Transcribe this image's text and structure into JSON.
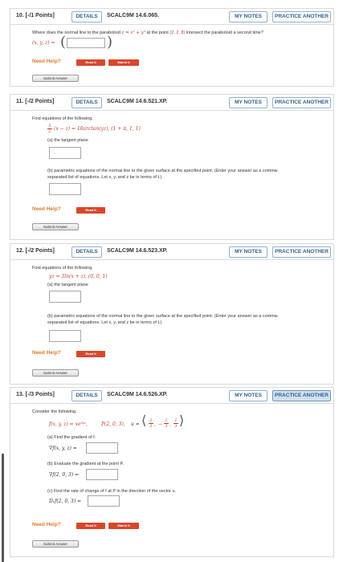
{
  "common": {
    "details_label": "DETAILS",
    "my_notes_label": "MY NOTES",
    "practice_label": "PRACTICE ANOTHER",
    "need_help": "Need Help?",
    "read_it": "Read It",
    "watch_it": "Watch It",
    "submit_answer": "Submit Answer"
  },
  "q10": {
    "number": "10. [-/1 Points]",
    "code": "SCALC9M 14.6.065.",
    "prompt_start": "Where does the normal line to the paraboloid ",
    "prompt_expr": "z = x² + y²",
    "prompt_mid": " at the point ",
    "prompt_point": "(2, 2, 8)",
    "prompt_end": " intersect the paraboloid a second time?",
    "answer_label": "(x, y, z) ="
  },
  "q11": {
    "number": "11. [-/2 Points]",
    "code": "SCALC9M 14.6.521.XP.",
    "prompt": "Find equations of the following.",
    "frac_num": "5",
    "frac_den": "2",
    "equation": "(x − z) = 10arctan(yz),   (1 + π, 1, 1)",
    "part_a": "(a) the tangent plane",
    "part_b_line1": "(b) parametric equations of the normal line to the given surface at the specified point. (Enter your answer as a comma-",
    "part_b_line2": "separated list of equations. Let x, y, and z be in terms of t.)"
  },
  "q12": {
    "number": "12. [-/2 Points]",
    "code": "SCALC9M 14.6.523.XP.",
    "prompt": "Find equations of the following.",
    "equation": "yz = 3ln(x + z),  (0, 0, 1)",
    "part_a": "(a) the tangent plane",
    "part_b_line1": "(b) parametric equations of the normal line to the given surface at the specified point. (Enter your answer as a comma-",
    "part_b_line2": "separated list of equations. Let x, y, and z be in terms of t.)"
  },
  "q13": {
    "number": "13. [-/3 Points]",
    "code": "SCALC9M 14.6.526.XP.",
    "prompt": "Consider the following.",
    "function": "f(x, y, z) = xe⁵ʸᶻ,",
    "point": "P(2, 0, 3),",
    "u_label": "u =",
    "u_1_num": "2",
    "u_1_den": "3",
    "u_2_num": "2",
    "u_2_den": "3",
    "u_3_num": "1",
    "u_3_den": "3",
    "part_a": "(a) Find the gradient of f.",
    "grad_label": "∇f(x, y, z) =",
    "part_b": "(b) Evaluate the gradient at the point P.",
    "grad_p_label": "∇f(2, 0, 3) =",
    "part_c": "(c) Find the rate of change of f at P in the direction of the vector u.",
    "du_label": "Dᵤf(2, 0, 3) ="
  }
}
